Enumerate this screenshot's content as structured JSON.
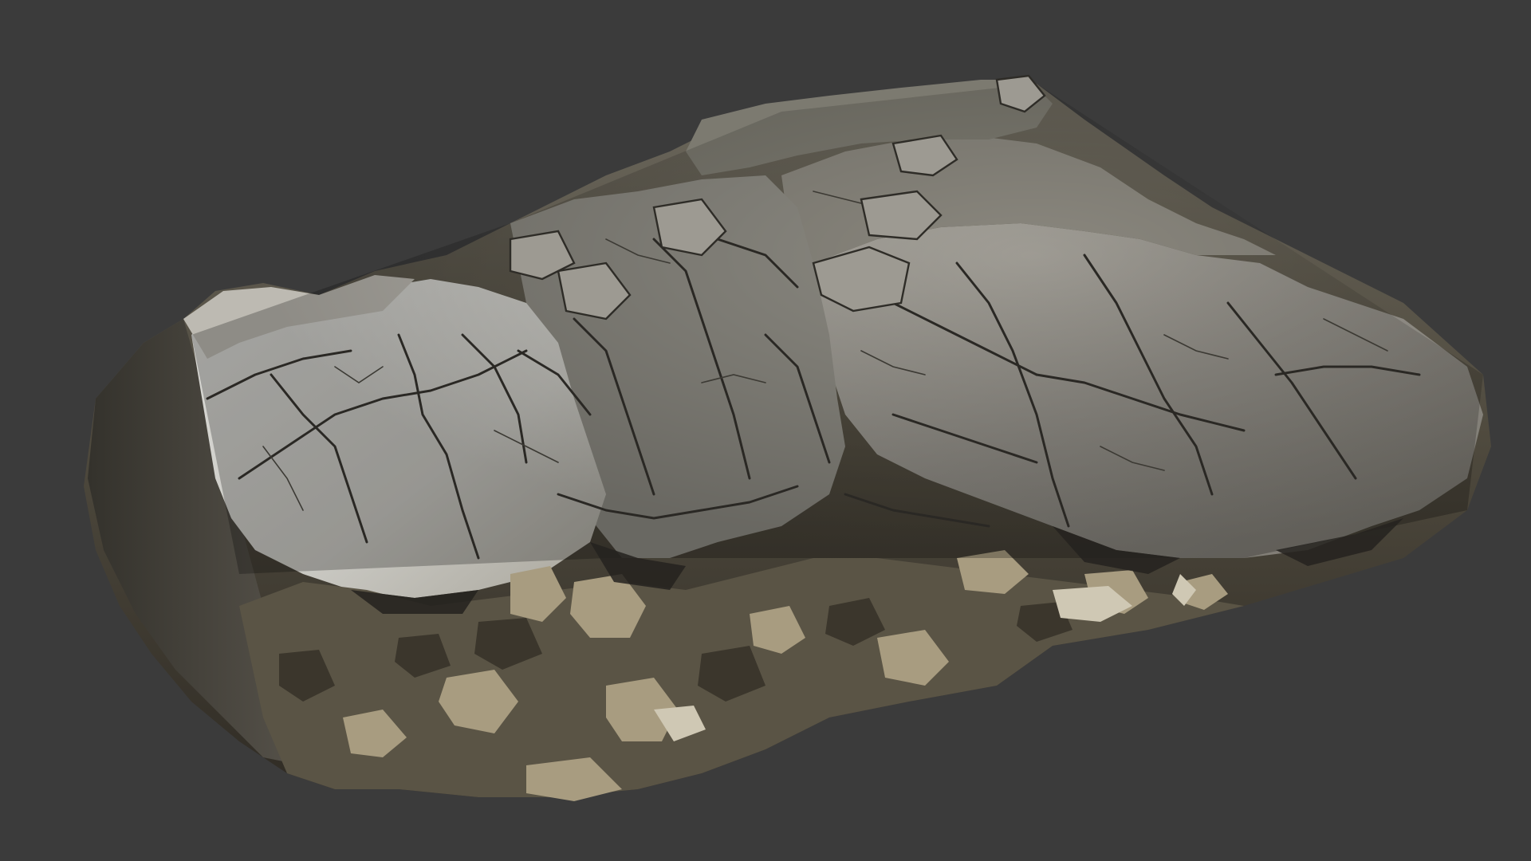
{
  "scene": {
    "subject": "rock-outcrop-scan",
    "background_color": "#3b3b3b",
    "colors": {
      "slab_light": "#cfcfcb",
      "slab_mid": "#9c9a94",
      "slab_dark": "#6e6c66",
      "crack": "#2a2824",
      "rubble_light": "#b8ad92",
      "rubble_dark": "#3e3a32",
      "shadow": "#24221e"
    }
  }
}
